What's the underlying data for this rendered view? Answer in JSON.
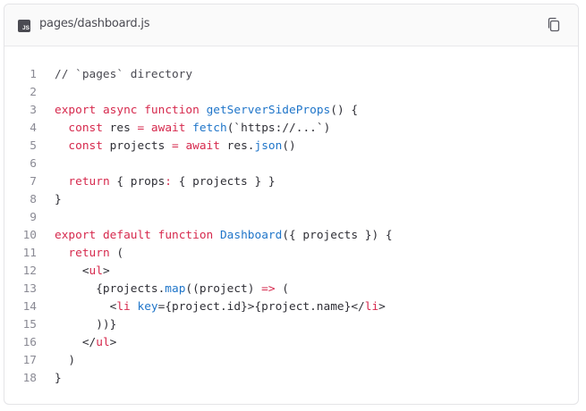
{
  "file": {
    "name": "pages/dashboard.js",
    "icon": "js-file-icon",
    "icon_label": "JS"
  },
  "copy_icon": "copy-icon",
  "colors": {
    "keyword": "#d6294d",
    "function": "#1f75c9",
    "text": "#2f2f36",
    "line_number": "#8a8a94"
  },
  "lines": [
    {
      "n": "1",
      "tokens": [
        {
          "t": "// `pages` directory",
          "c": "cm"
        }
      ]
    },
    {
      "n": "2",
      "tokens": []
    },
    {
      "n": "3",
      "tokens": [
        {
          "t": "export",
          "c": "kw"
        },
        {
          "t": " "
        },
        {
          "t": "async",
          "c": "kw"
        },
        {
          "t": " "
        },
        {
          "t": "function",
          "c": "kw"
        },
        {
          "t": " "
        },
        {
          "t": "getServerSideProps",
          "c": "fn"
        },
        {
          "t": "() {"
        }
      ]
    },
    {
      "n": "4",
      "tokens": [
        {
          "t": "  "
        },
        {
          "t": "const",
          "c": "kw"
        },
        {
          "t": " res "
        },
        {
          "t": "=",
          "c": "kw"
        },
        {
          "t": " "
        },
        {
          "t": "await",
          "c": "kw"
        },
        {
          "t": " "
        },
        {
          "t": "fetch",
          "c": "fn"
        },
        {
          "t": "(`https://...`)"
        }
      ]
    },
    {
      "n": "5",
      "tokens": [
        {
          "t": "  "
        },
        {
          "t": "const",
          "c": "kw"
        },
        {
          "t": " projects "
        },
        {
          "t": "=",
          "c": "kw"
        },
        {
          "t": " "
        },
        {
          "t": "await",
          "c": "kw"
        },
        {
          "t": " res."
        },
        {
          "t": "json",
          "c": "fn"
        },
        {
          "t": "()"
        }
      ]
    },
    {
      "n": "6",
      "tokens": []
    },
    {
      "n": "7",
      "tokens": [
        {
          "t": "  "
        },
        {
          "t": "return",
          "c": "kw"
        },
        {
          "t": " { props"
        },
        {
          "t": ":",
          "c": "kw"
        },
        {
          "t": " { projects } }"
        }
      ]
    },
    {
      "n": "8",
      "tokens": [
        {
          "t": "}"
        }
      ]
    },
    {
      "n": "9",
      "tokens": []
    },
    {
      "n": "10",
      "tokens": [
        {
          "t": "export",
          "c": "kw"
        },
        {
          "t": " "
        },
        {
          "t": "default",
          "c": "kw"
        },
        {
          "t": " "
        },
        {
          "t": "function",
          "c": "kw"
        },
        {
          "t": " "
        },
        {
          "t": "Dashboard",
          "c": "fn"
        },
        {
          "t": "({ projects }) {"
        }
      ]
    },
    {
      "n": "11",
      "tokens": [
        {
          "t": "  "
        },
        {
          "t": "return",
          "c": "kw"
        },
        {
          "t": " ("
        }
      ]
    },
    {
      "n": "12",
      "tokens": [
        {
          "t": "    <"
        },
        {
          "t": "ul",
          "c": "kw"
        },
        {
          "t": ">"
        }
      ]
    },
    {
      "n": "13",
      "tokens": [
        {
          "t": "      {projects."
        },
        {
          "t": "map",
          "c": "fn"
        },
        {
          "t": "((project) "
        },
        {
          "t": "=>",
          "c": "kw"
        },
        {
          "t": " ("
        }
      ]
    },
    {
      "n": "14",
      "tokens": [
        {
          "t": "        <"
        },
        {
          "t": "li",
          "c": "kw"
        },
        {
          "t": " "
        },
        {
          "t": "key",
          "c": "fn"
        },
        {
          "t": "={project.id}>{project.name}</"
        },
        {
          "t": "li",
          "c": "kw"
        },
        {
          "t": ">"
        }
      ]
    },
    {
      "n": "15",
      "tokens": [
        {
          "t": "      ))}"
        }
      ]
    },
    {
      "n": "16",
      "tokens": [
        {
          "t": "    </"
        },
        {
          "t": "ul",
          "c": "kw"
        },
        {
          "t": ">"
        }
      ]
    },
    {
      "n": "17",
      "tokens": [
        {
          "t": "  )"
        }
      ]
    },
    {
      "n": "18",
      "tokens": [
        {
          "t": "}"
        }
      ]
    }
  ]
}
